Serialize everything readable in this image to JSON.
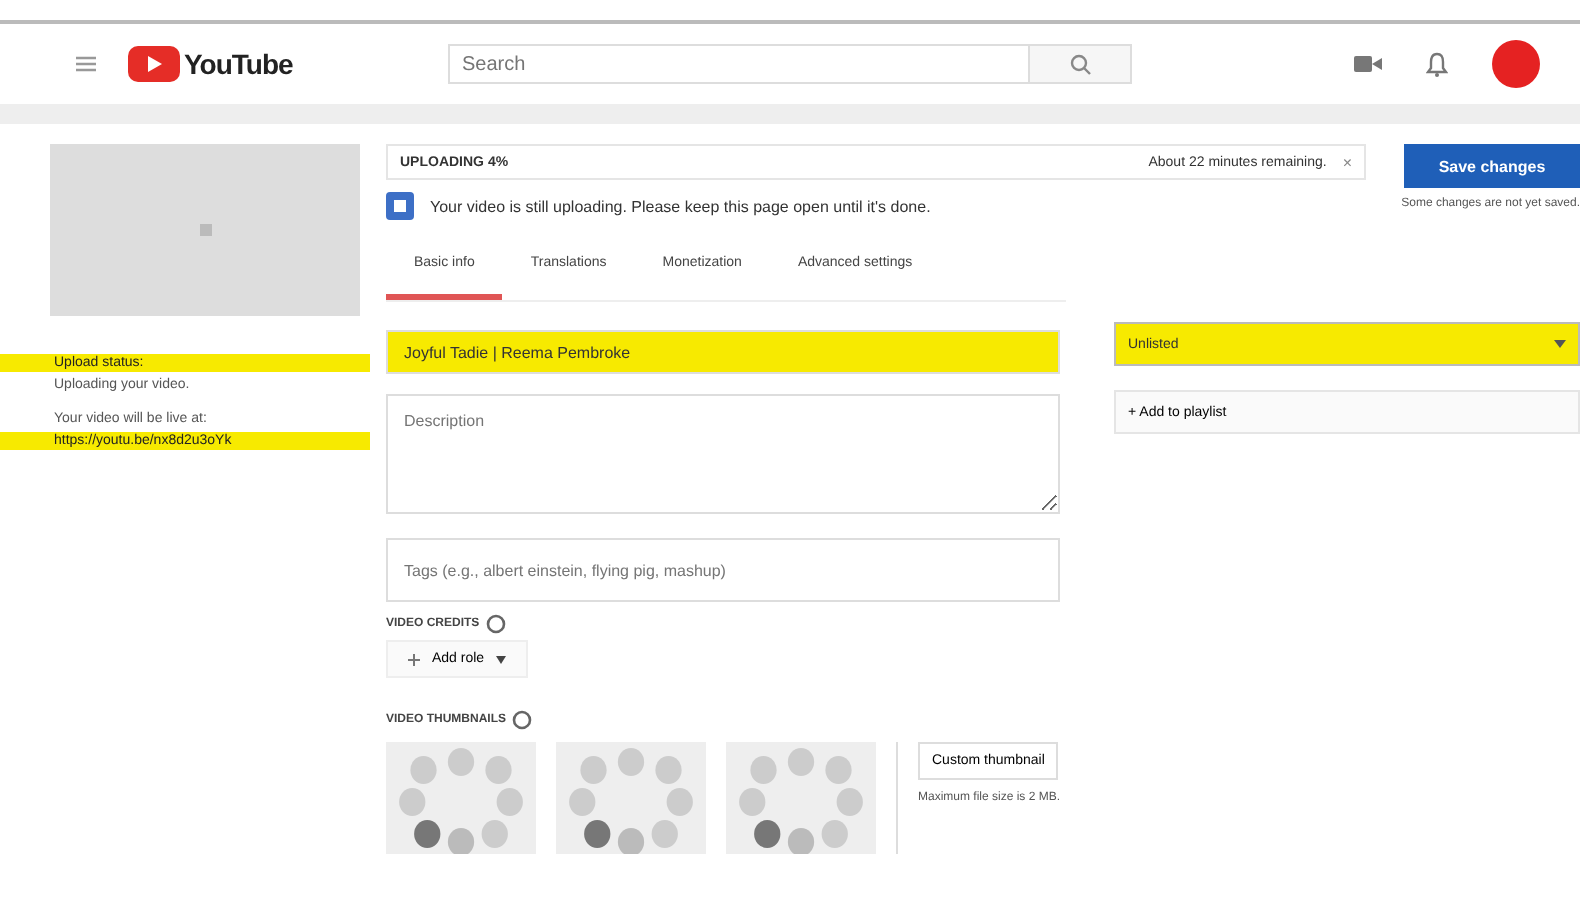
{
  "header": {
    "logo": "YouTube",
    "search": {
      "placeholder": "Search"
    }
  },
  "upload": {
    "status": "UPLOADING 4%",
    "message": "Your video is still uploading. Please keep this page open until it's done.",
    "remaining": "About 22 minutes remaining.",
    "cancel": "×",
    "save": "Save changes",
    "save_note": "Some changes are not yet saved."
  },
  "tabs": [
    {
      "label": "Basic info",
      "selected": true
    },
    {
      "label": "Translations",
      "selected": false
    },
    {
      "label": "Monetization",
      "selected": false
    },
    {
      "label": "Advanced settings",
      "selected": false
    }
  ],
  "side": [
    {
      "text": "Upload status:",
      "highlighted": true
    },
    {
      "text": "Uploading your video.",
      "highlighted": false
    },
    {
      "text": "Your video will be live at:",
      "highlighted": false
    },
    {
      "text": "https://youtu.be/nx8d2u3oYk",
      "highlighted": true
    }
  ],
  "form": {
    "title": {
      "value": "Joyful Tadie | Reema Pembroke",
      "highlighted": true
    },
    "description": {
      "placeholder": "Description"
    },
    "tags": {
      "placeholder": "Tags (e.g., albert einstein, flying pig, mashup)"
    },
    "credits_label": "VIDEO CREDITS",
    "add_role": "Add role",
    "thumbnails_label": "VIDEO THUMBNAILS",
    "custom_thumbnail": "Custom thumbnail",
    "max_size": "Maximum file size is 2 MB."
  },
  "privacy": {
    "value": "Unlisted",
    "highlighted": true
  },
  "playlist": "+ Add to playlist"
}
